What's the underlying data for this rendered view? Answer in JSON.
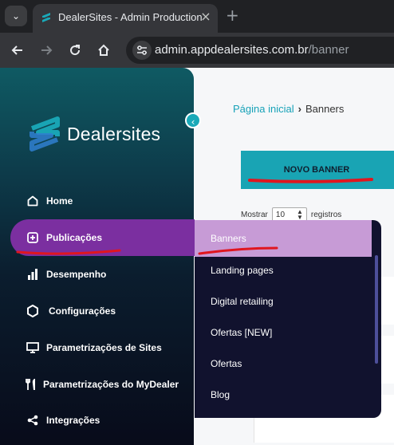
{
  "browser": {
    "tab_title": "DealerSites - Admin Production",
    "url_host": "admin.appdealersites.com.br",
    "url_path": "/banner"
  },
  "sidebar": {
    "logo_text_bold": "Dealer",
    "logo_text_light": "sites",
    "items": [
      {
        "label": "Home",
        "icon": "home-icon"
      },
      {
        "label": "Publicações",
        "icon": "plus-square-icon"
      },
      {
        "label": "Desempenho",
        "icon": "bar-chart-icon"
      },
      {
        "label": "Configurações",
        "icon": "hexagon-icon"
      },
      {
        "label": "Parametrizações de Sites",
        "icon": "monitor-icon"
      },
      {
        "label": "Parametrizações do MyDealer",
        "icon": "tools-icon"
      },
      {
        "label": "Integrações",
        "icon": "share-icon"
      }
    ],
    "active_item": "Publicações"
  },
  "submenu": {
    "items": [
      "Banners",
      "Landing pages",
      "Digital retailing",
      "Ofertas [NEW]",
      "Ofertas",
      "Blog"
    ],
    "active_item": "Banners"
  },
  "main": {
    "breadcrumb_home": "Página inicial",
    "breadcrumb_current": "Banners",
    "new_banner_label": "NOVO BANNER",
    "show_label": "Mostrar",
    "page_size": "10",
    "records_label": "registros"
  },
  "colors": {
    "accent": "#19a4b4",
    "active_menu": "#7b2fa0",
    "submenu_active": "#c79bd6",
    "annotation": "#e0161f"
  }
}
